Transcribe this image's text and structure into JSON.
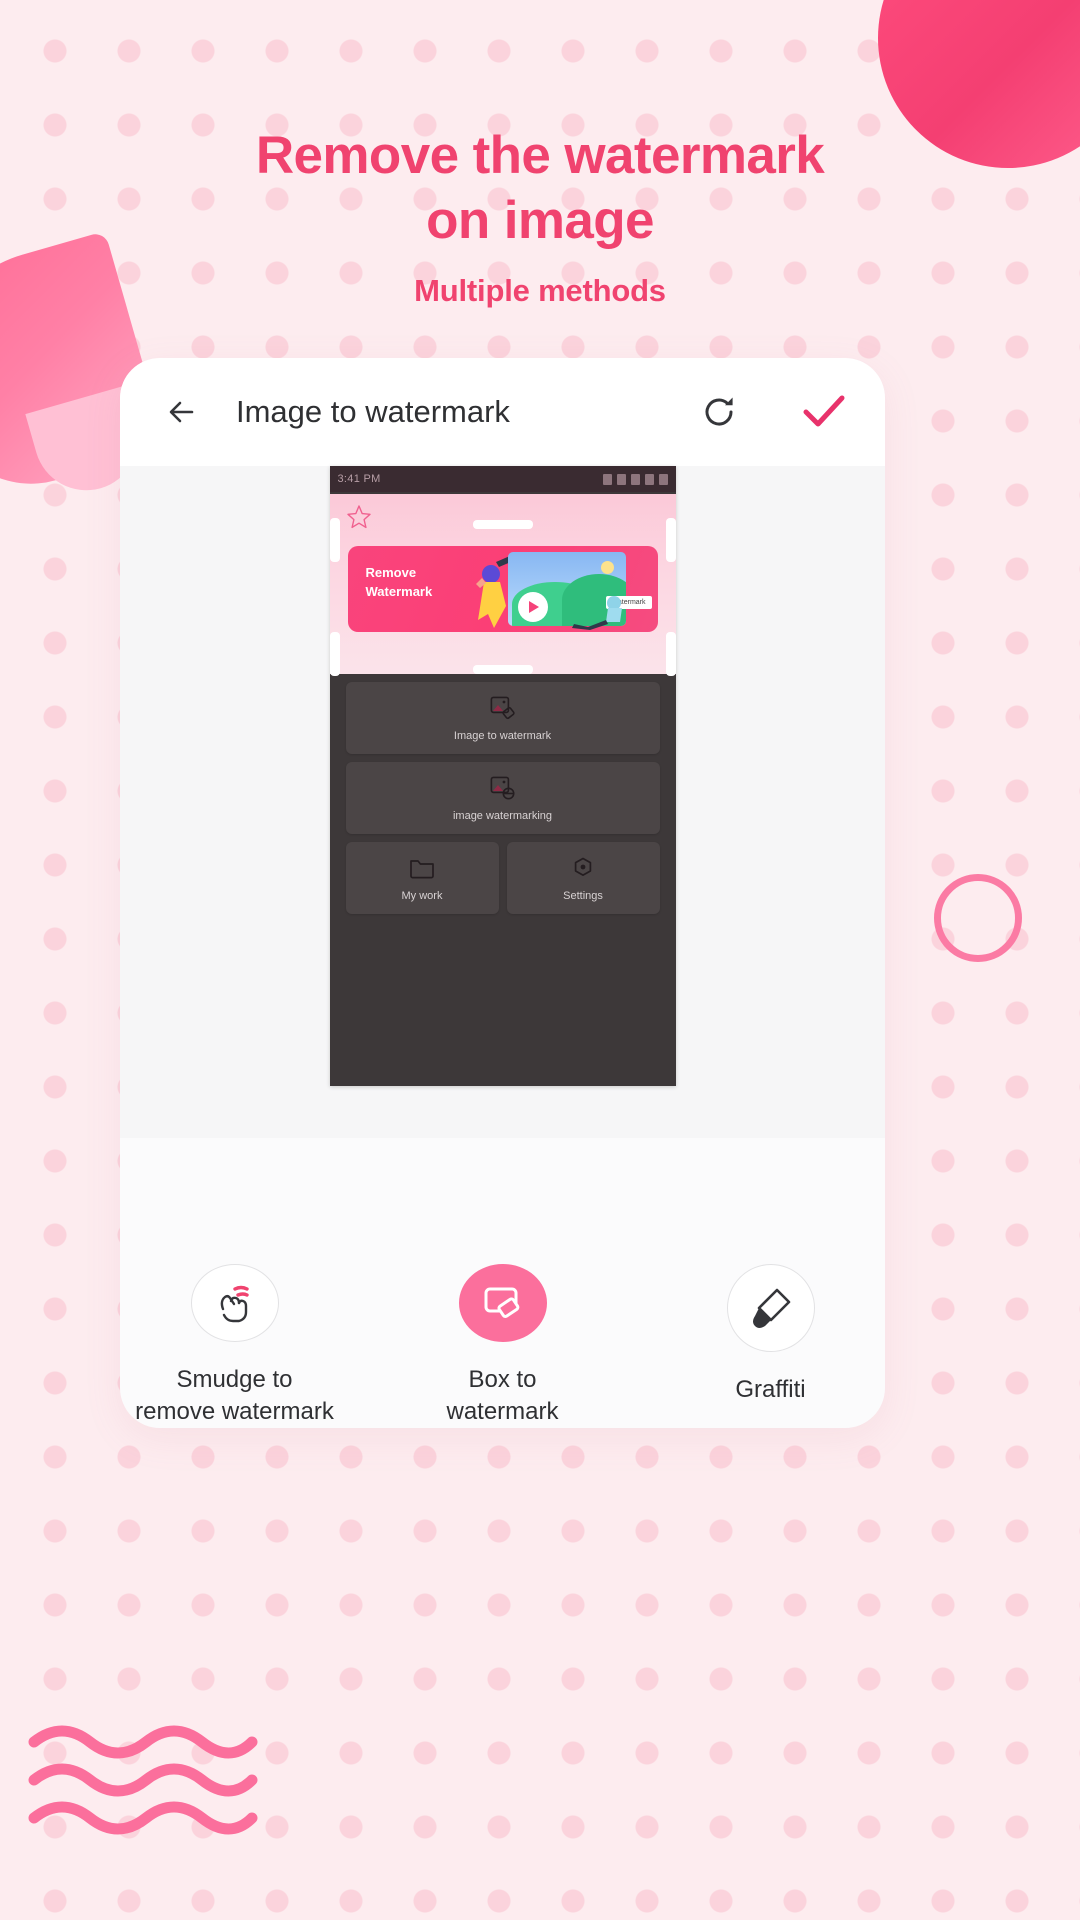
{
  "promo": {
    "headline": "Remove the watermark on image",
    "headline_line1": "Remove the watermark",
    "headline_line2": "on image",
    "subheadline": "Multiple methods",
    "accent_color": "#f0436f",
    "background_color": "#fdecef",
    "dot_color": "#fbd3dc"
  },
  "phone": {
    "header": {
      "back_icon": "arrow-left-icon",
      "title": "Image to watermark",
      "refresh_icon": "refresh-icon",
      "confirm_icon": "check-icon",
      "confirm_color": "#e8326b"
    },
    "canvas": {
      "inner_screenshot": {
        "status_bar": {
          "time": "3:41 PM"
        },
        "banner": {
          "title_line1": "Remove",
          "title_line2": "Watermark",
          "watermark_tag": "Watermark",
          "play_icon": "play-icon",
          "star_icon": "star-icon"
        },
        "menu_items": [
          {
            "label": "Image to watermark",
            "icon": "image-tag-icon"
          },
          {
            "label": "image watermarking",
            "icon": "image-stamp-icon"
          },
          {
            "label": "My work",
            "icon": "folder-icon"
          },
          {
            "label": "Settings",
            "icon": "gear-icon"
          }
        ]
      }
    },
    "tools": [
      {
        "label": "Smudge to remove watermark",
        "icon": "smudge-hand-icon",
        "active": false
      },
      {
        "label": "Box to watermark",
        "icon": "box-eraser-icon",
        "active": true
      },
      {
        "label": "Graffiti",
        "icon": "brush-icon",
        "active": false
      }
    ]
  }
}
